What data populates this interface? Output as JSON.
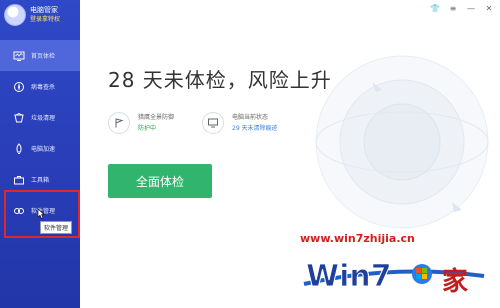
{
  "sidebar": {
    "app_name": "电脑管家",
    "login_link": "登录拿特权",
    "items": [
      {
        "label": "首页体检",
        "icon": "monitor-check-icon",
        "active": true
      },
      {
        "label": "病毒查杀",
        "icon": "virus-scan-icon",
        "active": false
      },
      {
        "label": "垃圾清理",
        "icon": "trash-clean-icon",
        "active": false
      },
      {
        "label": "电脑加速",
        "icon": "rocket-icon",
        "active": false
      },
      {
        "label": "工具箱",
        "icon": "toolbox-icon",
        "active": false
      },
      {
        "label": "软件管理",
        "icon": "software-icon",
        "active": false
      }
    ],
    "tooltip": "软件管理"
  },
  "main": {
    "headline": "28 天未体检，风险上升",
    "status": [
      {
        "title": "猎鹰全景防御",
        "value": "防护中",
        "icon": "shield-flag-icon"
      },
      {
        "title": "电脑当前状态",
        "value": "29 天未清除痕迹",
        "icon": "monitor-icon"
      }
    ],
    "scan_button": "全面体检"
  },
  "watermark": {
    "url": "www.win7zhijia.cn",
    "logo_text": "Win7",
    "logo_suffix": "家"
  },
  "colors": {
    "sidebar": "#2a3fba",
    "accent_green": "#31b56e",
    "status_green": "#2ea44f",
    "highlight_red": "#e12727"
  }
}
